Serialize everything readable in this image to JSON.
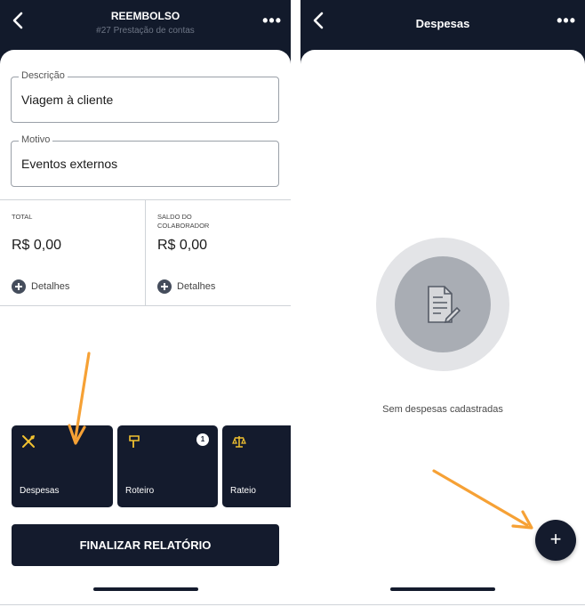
{
  "left_screen": {
    "header": {
      "title": "REEMBOLSO",
      "subtitle": "#27 Prestação de contas"
    },
    "fields": {
      "descricao": {
        "label": "Descrição",
        "value": "Viagem à cliente"
      },
      "motivo": {
        "label": "Motivo",
        "value": "Eventos externos"
      }
    },
    "summary": {
      "total": {
        "label": "TOTAL",
        "value": "R$ 0,00",
        "details": "Detalhes"
      },
      "saldo": {
        "label_line1": "SALDO DO",
        "label_line2": "COLABORADOR",
        "value": "R$ 0,00",
        "details": "Detalhes"
      }
    },
    "tiles": [
      {
        "label": "Despesas",
        "icon": "utensils-icon"
      },
      {
        "label": "Roteiro",
        "icon": "signpost-icon",
        "badge": "1"
      },
      {
        "label": "Rateio",
        "icon": "scale-icon"
      }
    ],
    "finalize_label": "FINALIZAR RELATÓRIO"
  },
  "right_screen": {
    "header": {
      "title": "Despesas"
    },
    "empty_message": "Sem despesas cadastradas",
    "fab_label": "+"
  },
  "colors": {
    "navy": "#121a2b",
    "accent_yellow": "#f2c230",
    "annotation_orange": "#f6a135",
    "empty_gray": "#a9adb4"
  }
}
